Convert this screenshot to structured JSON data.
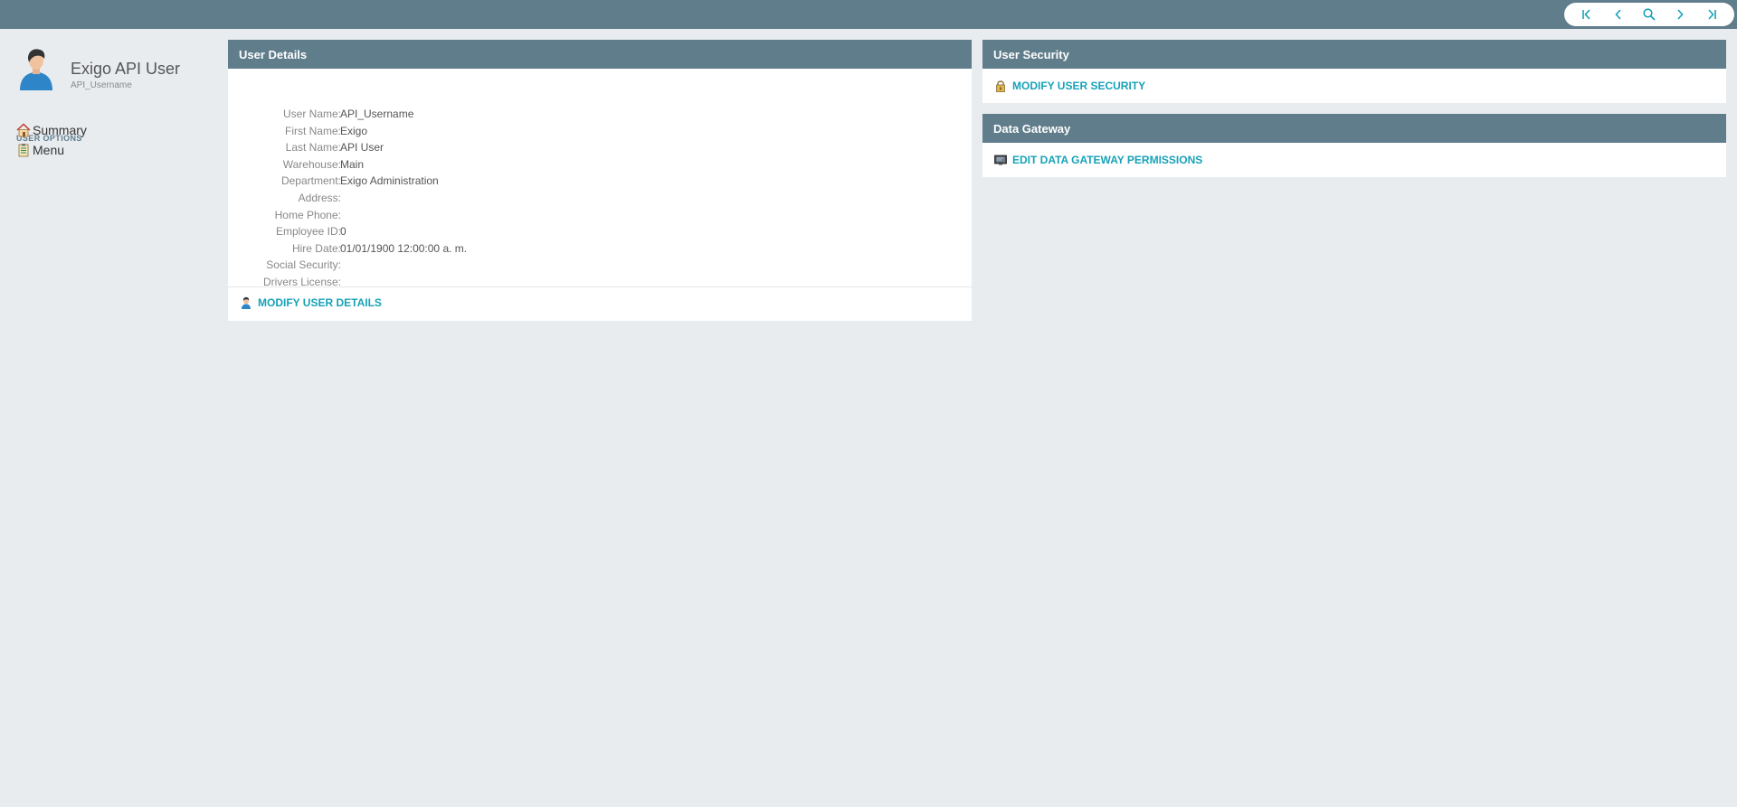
{
  "topbar": {
    "nav": [
      {
        "icon": "first-page-icon"
      },
      {
        "icon": "previous-icon"
      },
      {
        "icon": "search-icon"
      },
      {
        "icon": "next-icon"
      },
      {
        "icon": "last-page-icon"
      }
    ]
  },
  "profile": {
    "name": "Exigo API User",
    "username": "API_Username"
  },
  "sidebar": {
    "title": "USER OPTIONS",
    "items": [
      {
        "label": "Summary",
        "icon": "home-icon"
      },
      {
        "label": "Menu",
        "icon": "clipboard-icon"
      }
    ]
  },
  "user_details": {
    "title": "User Details",
    "rows": [
      {
        "label": "User Name:",
        "value": "API_Username"
      },
      {
        "label": "First Name:",
        "value": "Exigo"
      },
      {
        "label": "Last Name:",
        "value": "API User"
      },
      {
        "label": "Warehouse:",
        "value": "Main"
      },
      {
        "label": "Department:",
        "value": "Exigo Administration"
      },
      {
        "label": "Address:",
        "value": ""
      },
      {
        "label": "Home Phone:",
        "value": ""
      },
      {
        "label": "Employee ID:",
        "value": "0"
      },
      {
        "label": "Hire Date:",
        "value": "01/01/1900 12:00:00 a. m."
      },
      {
        "label": "Social Security:",
        "value": ""
      },
      {
        "label": "Drivers License:",
        "value": ""
      }
    ],
    "action": "MODIFY USER DETAILS"
  },
  "user_security": {
    "title": "User Security",
    "action": "MODIFY USER SECURITY"
  },
  "data_gateway": {
    "title": "Data Gateway",
    "action": "EDIT DATA GATEWAY PERMISSIONS"
  },
  "colors": {
    "header": "#607d8b",
    "background": "#e9ecef",
    "link": "#17a2b8"
  }
}
